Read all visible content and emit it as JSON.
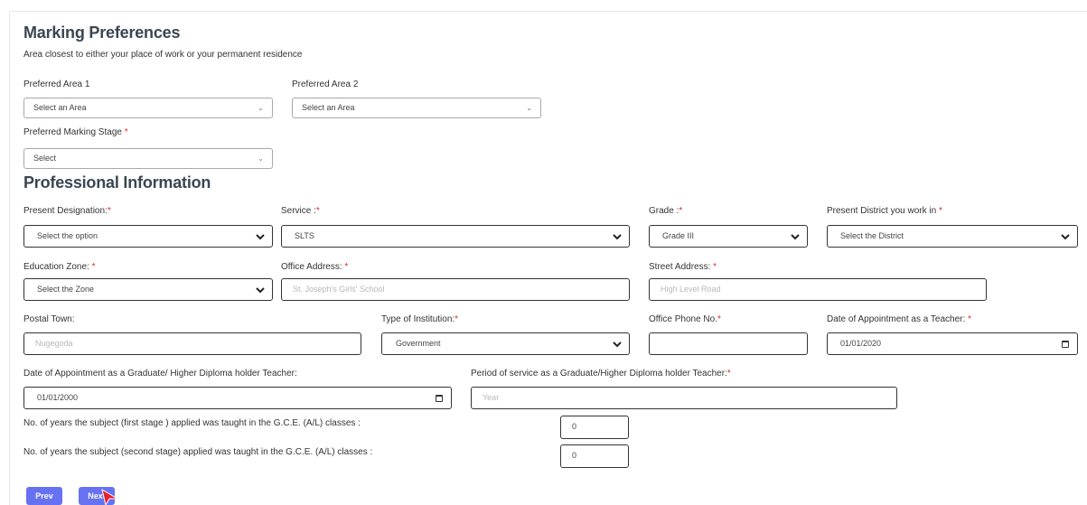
{
  "marking": {
    "title": "Marking Preferences",
    "subtitle": "Area closest to either your place of work or your permanent residence",
    "area1": {
      "label": "Preferred Area 1",
      "value": "Select an Area"
    },
    "area2": {
      "label": "Preferred Area 2",
      "value": "Select an Area"
    },
    "stage": {
      "label": "Preferred Marking Stage",
      "required": "*",
      "value": "Select"
    }
  },
  "professional": {
    "title": "Professional Information",
    "designation": {
      "label": "Present Designation:",
      "required": "*",
      "value": "Select the option"
    },
    "service": {
      "label": "Service :",
      "required": "*",
      "value": "SLTS"
    },
    "grade": {
      "label": "Grade :",
      "required": "*",
      "value": "Grade III"
    },
    "district": {
      "label": "Present District you work in",
      "required": "*",
      "value": "Select the District"
    },
    "zone": {
      "label": "Education Zone:",
      "required": "*",
      "value": "Select the Zone"
    },
    "office_address": {
      "label": "Office Address:",
      "required": "*",
      "placeholder": "St. Joseph's Girls' School"
    },
    "street_address": {
      "label": "Street Address:",
      "required": "*",
      "placeholder": "High Level Road"
    },
    "postal_town": {
      "label": "Postal Town:",
      "placeholder": "Nugegoda"
    },
    "institution": {
      "label": "Type of Institution:",
      "required": "*",
      "value": "Government"
    },
    "office_phone": {
      "label": "Office Phone No.",
      "required": "*",
      "value": ""
    },
    "appointment_teacher": {
      "label": "Date of Appointment as a Teacher:",
      "required": "*",
      "value": "01/01/2020"
    },
    "appointment_graduate": {
      "label": "Date of Appointment as a Graduate/ Higher Diploma holder Teacher:",
      "value": "01/01/2000"
    },
    "service_period": {
      "label": "Period of service as a Graduate/Higher Diploma holder Teacher:",
      "required": "*",
      "placeholder": "Year"
    },
    "years_first": {
      "label": "No. of years the subject (first stage ) applied was taught in the G.C.E. (A/L) classes :",
      "value": "0"
    },
    "years_second": {
      "label": "No. of years the subject (second stage) applied was taught in the G.C.E. (A/L) classes :",
      "value": "0"
    }
  },
  "buttons": {
    "prev": "Prev",
    "next": "Next"
  },
  "colors": {
    "accent": "#6672f2",
    "required": "#e0282e",
    "heading": "#3a4651"
  }
}
